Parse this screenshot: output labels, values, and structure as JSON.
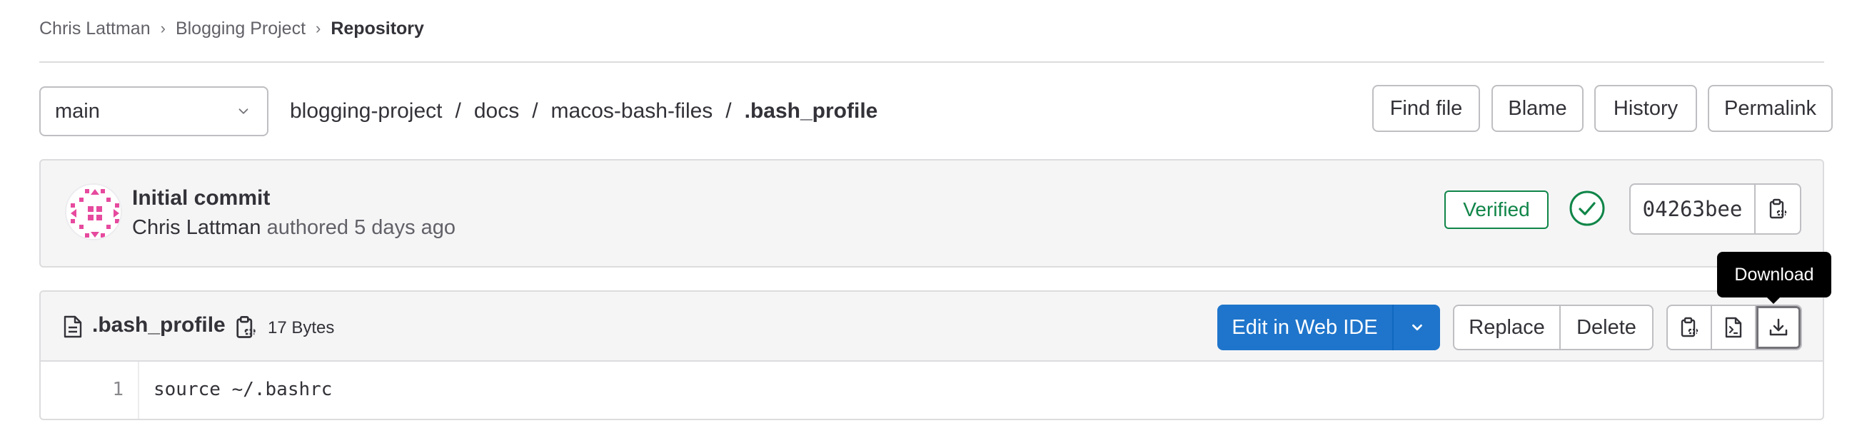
{
  "breadcrumb": {
    "items": [
      "Chris Lattman",
      "Blogging Project",
      "Repository"
    ]
  },
  "branch": {
    "selected": "main"
  },
  "path": {
    "segments": [
      "blogging-project",
      "docs",
      "macos-bash-files"
    ],
    "separator": "/",
    "file": ".bash_profile"
  },
  "actions": {
    "find_file": "Find file",
    "blame": "Blame",
    "history": "History",
    "permalink": "Permalink"
  },
  "commit": {
    "title": "Initial commit",
    "author": "Chris Lattman",
    "meta": "authored 5 days ago",
    "verified_label": "Verified",
    "pipeline_status": "passed",
    "sha": "04263bee"
  },
  "file": {
    "name": ".bash_profile",
    "size": "17 Bytes",
    "edit_label": "Edit in Web IDE",
    "replace_label": "Replace",
    "delete_label": "Delete",
    "lines": [
      {
        "number": "1",
        "text": "source ~/.bashrc"
      }
    ]
  },
  "tooltip": {
    "text": "Download"
  },
  "colors": {
    "primary": "#1f75cb",
    "success": "#108548",
    "avatar": "#e64a9e",
    "text": "#333238"
  },
  "icons": [
    "chevron-down-icon",
    "pipeline-passed-icon",
    "copy-icon",
    "file-icon",
    "raw-file-icon",
    "download-icon"
  ]
}
